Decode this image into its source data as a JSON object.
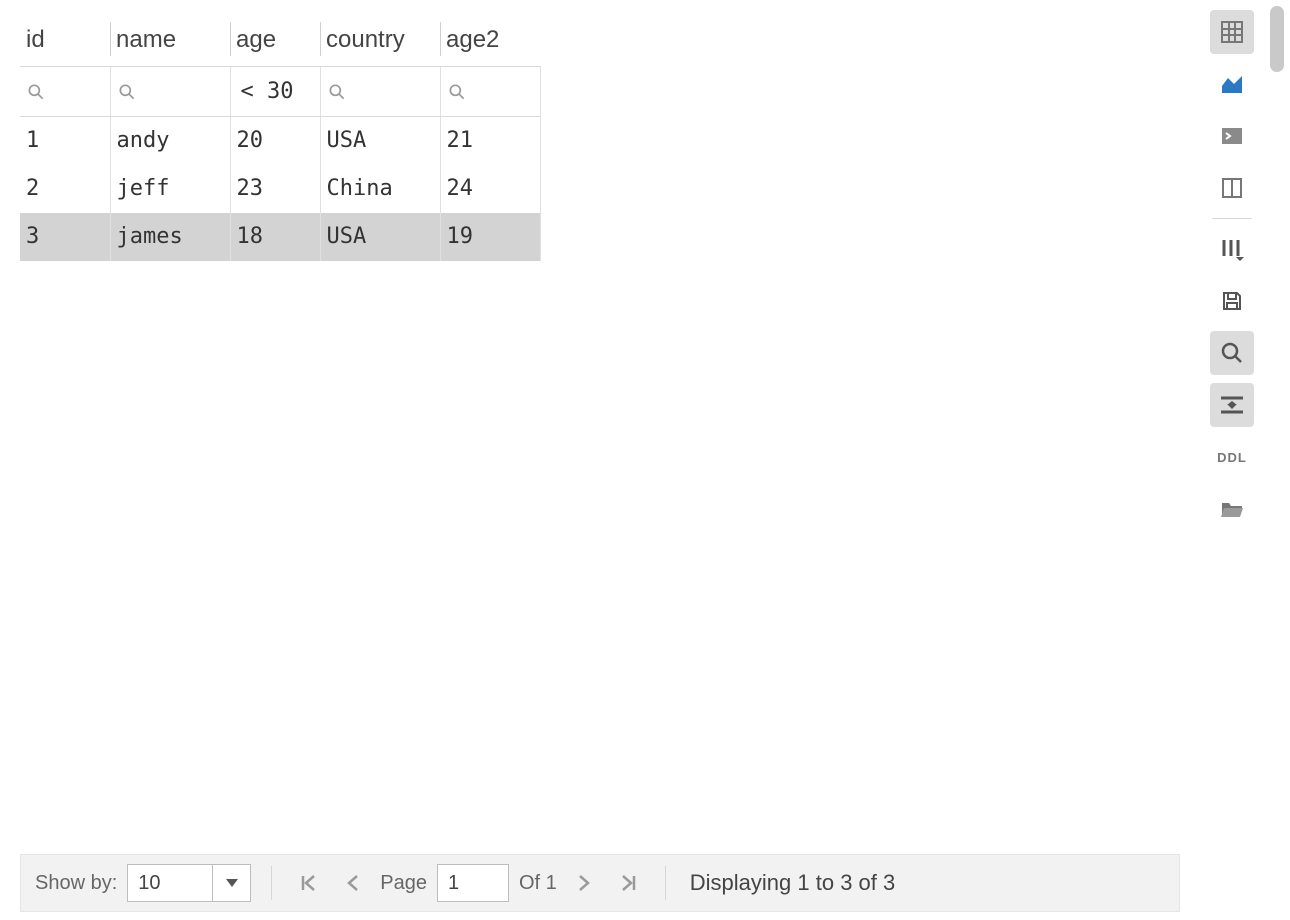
{
  "columns": [
    {
      "key": "id",
      "label": "id"
    },
    {
      "key": "name",
      "label": "name"
    },
    {
      "key": "age",
      "label": "age"
    },
    {
      "key": "country",
      "label": "country"
    },
    {
      "key": "age2",
      "label": "age2"
    }
  ],
  "filters": {
    "id": "",
    "name": "",
    "age": "< 30",
    "country": "",
    "age2": ""
  },
  "rows": [
    {
      "id": "1",
      "name": "andy",
      "age": "20",
      "country": "USA",
      "age2": "21",
      "selected": false
    },
    {
      "id": "2",
      "name": "jeff",
      "age": "23",
      "country": "China",
      "age2": "24",
      "selected": false
    },
    {
      "id": "3",
      "name": "james",
      "age": "18",
      "country": "USA",
      "age2": "19",
      "selected": true
    }
  ],
  "footer": {
    "show_by_label": "Show by:",
    "page_size": "10",
    "page_label": "Page",
    "page_value": "1",
    "of_label": "Of 1",
    "displaying": "Displaying 1 to 3 of 3"
  },
  "sidebar": {
    "ddl": "DDL"
  }
}
